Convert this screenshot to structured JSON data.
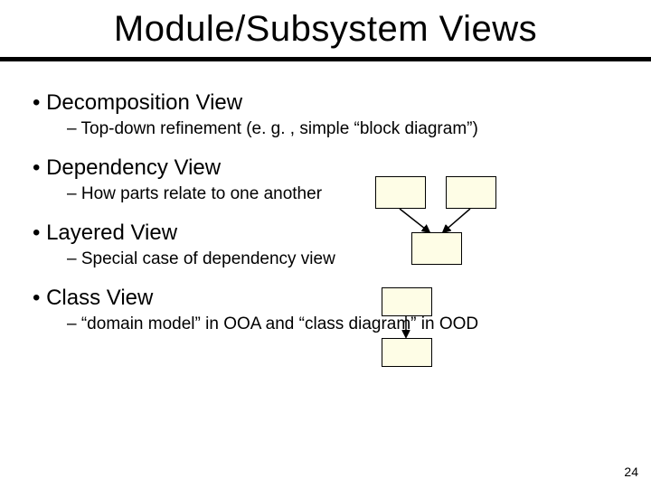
{
  "title": "Module/Subsystem Views",
  "bullets": [
    {
      "heading": "Decomposition View",
      "sub": "Top-down refinement (e. g. , simple “block diagram”)"
    },
    {
      "heading": "Dependency View",
      "sub": "How parts relate to one another"
    },
    {
      "heading": "Layered View",
      "sub": "Special case of dependency view"
    },
    {
      "heading": "Class View",
      "sub": "“domain model” in OOA and “class diagram” in OOD"
    }
  ],
  "page_number": "24"
}
